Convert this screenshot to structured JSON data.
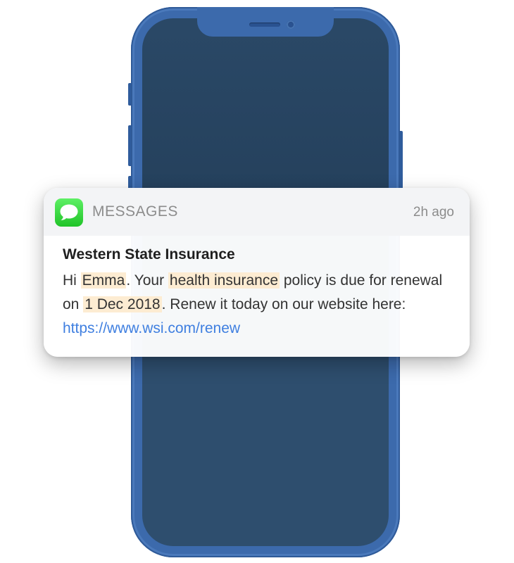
{
  "notification": {
    "app_name": "MESSAGES",
    "time": "2h ago",
    "icon": "messages-bubble-icon",
    "sender": "Western State Insurance",
    "body": {
      "part1": "Hi ",
      "name": "Emma",
      "part2": ". Your ",
      "product": "health insurance",
      "part3": " policy is due for renewal on ",
      "date": "1 Dec 2018",
      "part4": ". Renew it today on our website here: ",
      "link": "https://www.wsi.com/renew"
    }
  },
  "colors": {
    "phone_body": "#3c6aac",
    "phone_screen": "#2e4e6e",
    "app_icon_green": "#34d33b",
    "highlight": "#fdecd2",
    "link": "#3f7fe0"
  }
}
